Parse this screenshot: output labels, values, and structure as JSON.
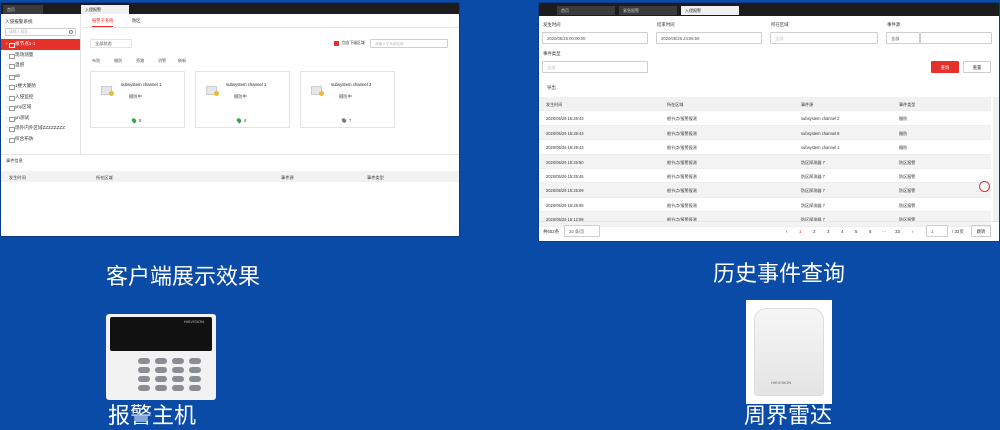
{
  "left_window": {
    "tabs": [
      "首页",
      "入侵报警"
    ],
    "sidebar_title": "入侵报警系统",
    "search_placeholder": "请输入搜索...",
    "tree": [
      "根节点1-1",
      "现场测量",
      "温感",
      "ab",
      "1楼大厦防",
      "入侵监控",
      "yny区域",
      "yn测试",
      "场外内外区域ZZZZZZZZ",
      "综合布防"
    ],
    "main_tabs": [
      "报警子系统",
      "防区"
    ],
    "filter_value": "全部状态",
    "show_children_label": "包含下级区域",
    "name_search_placeholder": "请输入子系统名称",
    "toolbar": [
      "布防",
      "撤防",
      "旁路",
      "消警",
      "刷新"
    ],
    "cards": [
      {
        "name": "subsystem channel 1",
        "status": "撤防中",
        "count": "8",
        "color": "#37a34f"
      },
      {
        "name": "subsystem channel 1",
        "status": "撤防中",
        "count": "6",
        "color": "#37a34f"
      },
      {
        "name": "subsystem channel 2",
        "status": "撤防中",
        "count": "7",
        "color": "#7c7c7c"
      }
    ],
    "events_title": "事件信息",
    "events_headers": [
      "发生时间",
      "所在区域",
      "事件源",
      "事件类型"
    ]
  },
  "right_window": {
    "tabs": [
      "首页",
      "紧急报警",
      "入侵报警"
    ],
    "filters": {
      "start_label": "发生时间",
      "start_value": "2020/05/26 00:00:00",
      "end_label": "结束时间",
      "end_value": "2020/05/26 23:59:59",
      "area_label": "所在区域",
      "area_placeholder": "全部",
      "source_label": "事件源",
      "source_value": "全部",
      "type_label": "事件类型",
      "type_placeholder": "全部",
      "search_button": "查询",
      "reset_button": "重置"
    },
    "export_label": "导出",
    "table_headers": [
      "发生时间",
      "所在区域",
      "事件源",
      "事件类型"
    ],
    "rows": [
      [
        "2020/05/26 15:28:43",
        "根节点/报警报测",
        "subsystem channel 2",
        "撤防"
      ],
      [
        "2020/05/26 15:28:43",
        "根节点/报警报测",
        "subsystem channel 8",
        "撤防"
      ],
      [
        "2020/05/26 15:28:43",
        "根节点/报警报测",
        "subsystem channel 1",
        "撤防"
      ],
      [
        "2020/05/26 15:25:50",
        "根节点/报警报测",
        "防区探测器 7",
        "防区报警"
      ],
      [
        "2020/05/26 15:25:46",
        "根节点/报警报测",
        "防区探测器 7",
        "防区报警"
      ],
      [
        "2020/05/26 15:25:09",
        "根节点/报警报测",
        "防区探测器 7",
        "防区报警"
      ],
      [
        "2020/05/26 15:25:05",
        "根节点/报警报测",
        "防区探测器 7",
        "防区报警"
      ],
      [
        "2020/05/26 15:12:08",
        "根节点/报警报测",
        "防区探测器 7",
        "防区报警"
      ]
    ],
    "pagination": {
      "total": "共652条",
      "page_size": "20 条/页",
      "pages": [
        "1",
        "2",
        "3",
        "4",
        "5",
        "6",
        "···",
        "33"
      ],
      "goto": "1",
      "page_count": "/ 33页",
      "jump": "跳转"
    }
  },
  "captions": {
    "left": "客户端展示效果",
    "right": "历史事件查询",
    "panel": "报警主机",
    "radar": "周界雷达"
  },
  "device_brand": "HIKVISION"
}
